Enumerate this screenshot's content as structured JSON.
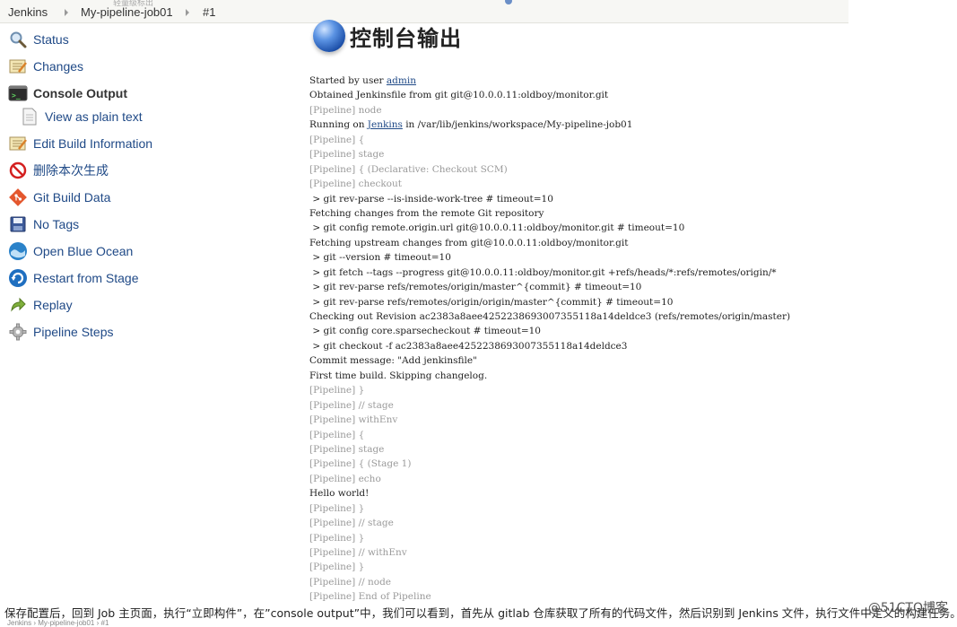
{
  "breadcrumb": {
    "items": [
      "Jenkins",
      "My-pipeline-job01",
      "#1"
    ],
    "ghost_text": "轻量级标出"
  },
  "sidebar": {
    "items": [
      {
        "label": "Status",
        "icon": "magnifier-icon"
      },
      {
        "label": "Changes",
        "icon": "notepad-icon"
      },
      {
        "label": "Console Output",
        "icon": "terminal-icon"
      },
      {
        "label": "View as plain text",
        "icon": "document-icon"
      },
      {
        "label": "Edit Build Information",
        "icon": "notepad-edit-icon"
      },
      {
        "label": "删除本次生成",
        "icon": "no-entry-icon"
      },
      {
        "label": "Git Build Data",
        "icon": "git-icon"
      },
      {
        "label": "No Tags",
        "icon": "save-icon"
      },
      {
        "label": "Open Blue Ocean",
        "icon": "blue-ocean-icon"
      },
      {
        "label": "Restart from Stage",
        "icon": "refresh-icon"
      },
      {
        "label": "Replay",
        "icon": "replay-arrow-icon"
      },
      {
        "label": "Pipeline Steps",
        "icon": "gear-icon"
      }
    ]
  },
  "page": {
    "title": "控制台输出"
  },
  "console": {
    "started_prefix": "Started by user ",
    "started_user": "admin",
    "running_prefix": "Running on ",
    "running_link": "Jenkins",
    "running_suffix": " in /var/lib/jenkins/workspace/My-pipeline-job01",
    "lines": [
      {
        "t": "Obtained Jenkinsfile from git git@10.0.0.11:oldboy/monitor.git",
        "dim": false
      },
      {
        "t": "[Pipeline] node",
        "dim": true
      },
      {
        "t": "[Pipeline] {",
        "dim": true
      },
      {
        "t": "[Pipeline] stage",
        "dim": true
      },
      {
        "t": "[Pipeline] { (Declarative: Checkout SCM)",
        "dim": true
      },
      {
        "t": "[Pipeline] checkout",
        "dim": true
      },
      {
        "t": " > git rev-parse --is-inside-work-tree # timeout=10",
        "dim": false
      },
      {
        "t": "Fetching changes from the remote Git repository",
        "dim": false
      },
      {
        "t": " > git config remote.origin.url git@10.0.0.11:oldboy/monitor.git # timeout=10",
        "dim": false
      },
      {
        "t": "Fetching upstream changes from git@10.0.0.11:oldboy/monitor.git",
        "dim": false
      },
      {
        "t": " > git --version # timeout=10",
        "dim": false
      },
      {
        "t": " > git fetch --tags --progress git@10.0.0.11:oldboy/monitor.git +refs/heads/*:refs/remotes/origin/*",
        "dim": false
      },
      {
        "t": " > git rev-parse refs/remotes/origin/master^{commit} # timeout=10",
        "dim": false
      },
      {
        "t": " > git rev-parse refs/remotes/origin/origin/master^{commit} # timeout=10",
        "dim": false
      },
      {
        "t": "Checking out Revision ac2383a8aee4252238693007355118a14deldce3 (refs/remotes/origin/master)",
        "dim": false
      },
      {
        "t": " > git config core.sparsecheckout # timeout=10",
        "dim": false
      },
      {
        "t": " > git checkout -f ac2383a8aee4252238693007355118a14deldce3",
        "dim": false
      },
      {
        "t": "Commit message: \"Add jenkinsfile\"",
        "dim": false
      },
      {
        "t": "First time build. Skipping changelog.",
        "dim": false
      },
      {
        "t": "[Pipeline] }",
        "dim": true
      },
      {
        "t": "[Pipeline] // stage",
        "dim": true
      },
      {
        "t": "[Pipeline] withEnv",
        "dim": true
      },
      {
        "t": "[Pipeline] {",
        "dim": true
      },
      {
        "t": "[Pipeline] stage",
        "dim": true
      },
      {
        "t": "[Pipeline] { (Stage 1)",
        "dim": true
      },
      {
        "t": "[Pipeline] echo",
        "dim": true
      },
      {
        "t": "Hello world!",
        "dim": false
      },
      {
        "t": "[Pipeline] }",
        "dim": true
      },
      {
        "t": "[Pipeline] // stage",
        "dim": true
      },
      {
        "t": "[Pipeline] }",
        "dim": true
      },
      {
        "t": "[Pipeline] // withEnv",
        "dim": true
      },
      {
        "t": "[Pipeline] }",
        "dim": true
      },
      {
        "t": "[Pipeline] // node",
        "dim": true
      },
      {
        "t": "[Pipeline] End of Pipeline",
        "dim": true
      }
    ]
  },
  "caption": {
    "text": "保存配置后，回到 Job 主页面，执行“立即构件”，在”console output”中，我们可以看到，首先从 gitlab 仓库获取了所有的代码文件，然后识别到 Jenkins 文件，执行文件中定义的构建任务。",
    "watermark": "@51CTO博客",
    "mini_breadcrumb": "Jenkins  ›  My-pipeline-job01  ›  #1"
  },
  "colors": {
    "link": "#204a87",
    "dim_text": "#9a9a9a",
    "topbar_bg": "#f7f7f4"
  }
}
